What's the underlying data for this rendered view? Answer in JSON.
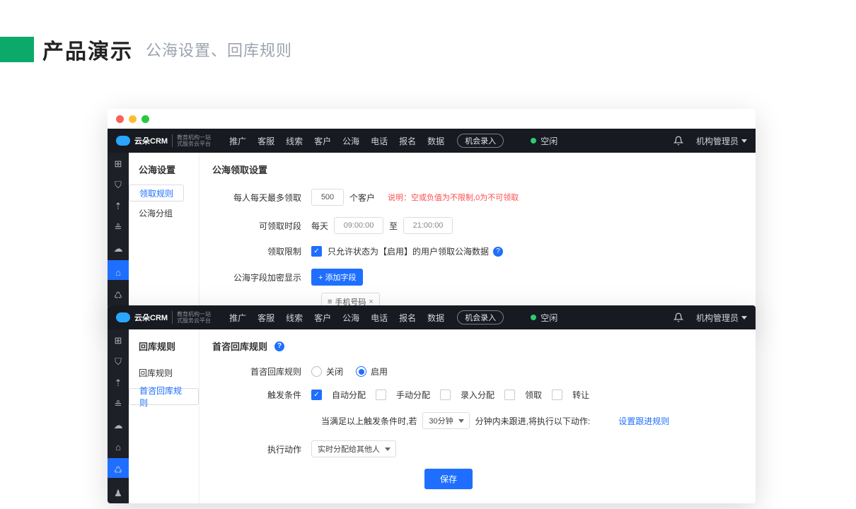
{
  "slide": {
    "title": "产品演示",
    "subtitle": "公海设置、回库规则"
  },
  "brand": {
    "name": "云朵CRM",
    "sub1": "教育机构一站",
    "sub2": "式服务云平台"
  },
  "nav": {
    "items": [
      "推广",
      "客服",
      "线索",
      "客户",
      "公海",
      "电话",
      "报名",
      "数据"
    ],
    "action": "机会录入",
    "status": "空闲",
    "user": "机构管理员"
  },
  "win1": {
    "side_header": "公海设置",
    "side_items": [
      "领取规则",
      "公海分组"
    ],
    "section": "公海领取设置",
    "row1": {
      "label": "每人每天最多领取",
      "value": "500",
      "unit": "个客户",
      "note_prefix": "说明：",
      "note_body": "空或负值为不限制,0为不可领取"
    },
    "row2": {
      "label": "可领取时段",
      "prefix": "每天",
      "from": "09:00:00",
      "sep": "至",
      "to": "21:00:00"
    },
    "row3": {
      "label": "领取限制",
      "text": "只允许状态为【启用】的用户领取公海数据"
    },
    "row4": {
      "label": "公海字段加密显示",
      "btn": "+ 添加字段",
      "tag_icon": "≡",
      "tag": "手机号码",
      "tag_x": "×"
    }
  },
  "win2": {
    "side_header": "回库规则",
    "side_items": [
      "回库规则",
      "首咨回库规则"
    ],
    "section": "首咨回库规则",
    "row1": {
      "label": "首咨回库规则",
      "off": "关闭",
      "on": "启用"
    },
    "row2": {
      "label": "触发条件",
      "opts": [
        "自动分配",
        "手动分配",
        "录入分配",
        "领取",
        "转让"
      ]
    },
    "row3": {
      "text1": "当满足以上触发条件时,若",
      "sel": "30分钟",
      "text2": "分钟内未跟进,将执行以下动作:",
      "link": "设置跟进规则"
    },
    "row4": {
      "label": "执行动作",
      "sel": "实时分配给其他人"
    },
    "save": "保存"
  }
}
